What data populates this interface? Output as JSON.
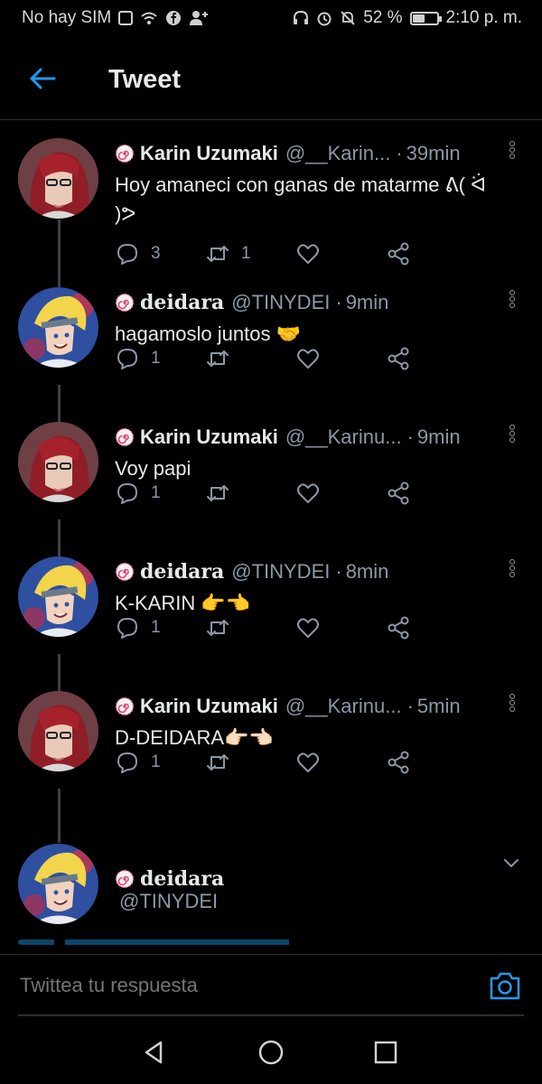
{
  "status_bar": {
    "carrier": "No hay SIM",
    "battery": "52 %",
    "battery_level": 0.52,
    "time": "2:10 p. m."
  },
  "header": {
    "title": "Tweet"
  },
  "tweets": [
    {
      "name": "Karin Uzumaki",
      "handle": "@__Karin...",
      "time": "39min",
      "text": "Hoy amaneci con ganas de matarme ᕕ( ᐛ )ᕗ",
      "replies": "3",
      "retweets": "1",
      "likes": "",
      "avatar": "karin"
    },
    {
      "name": "deidara",
      "handle": "@TINYDEI",
      "time": "9min",
      "text": "hagamoslo juntos 🤝",
      "replies": "1",
      "retweets": "",
      "likes": "",
      "avatar": "deidara"
    },
    {
      "name": "Karin Uzumaki",
      "handle": "@__Karinu...",
      "time": "9min",
      "text": "Voy papi",
      "replies": "1",
      "retweets": "",
      "likes": "",
      "avatar": "karin"
    },
    {
      "name": "deidara",
      "handle": "@TINYDEI",
      "time": "8min",
      "text": "K-KARIN 👉👈",
      "replies": "1",
      "retweets": "",
      "likes": "",
      "avatar": "deidara"
    },
    {
      "name": "Karin Uzumaki",
      "handle": "@__Karinu...",
      "time": "5min",
      "text": "D-DEIDARA👉🏻👈🏻",
      "replies": "1",
      "retweets": "",
      "likes": "",
      "avatar": "karin"
    }
  ],
  "focused_tweet": {
    "name": "deidara",
    "handle": "@TINYDEI"
  },
  "reply_bar": {
    "placeholder": "Twittea tu respuesta"
  },
  "colors": {
    "background": "#000000",
    "text": "#e7e9ea",
    "muted": "#8b98a5",
    "accent": "#1d9bf0",
    "divider": "#2a2e33"
  }
}
